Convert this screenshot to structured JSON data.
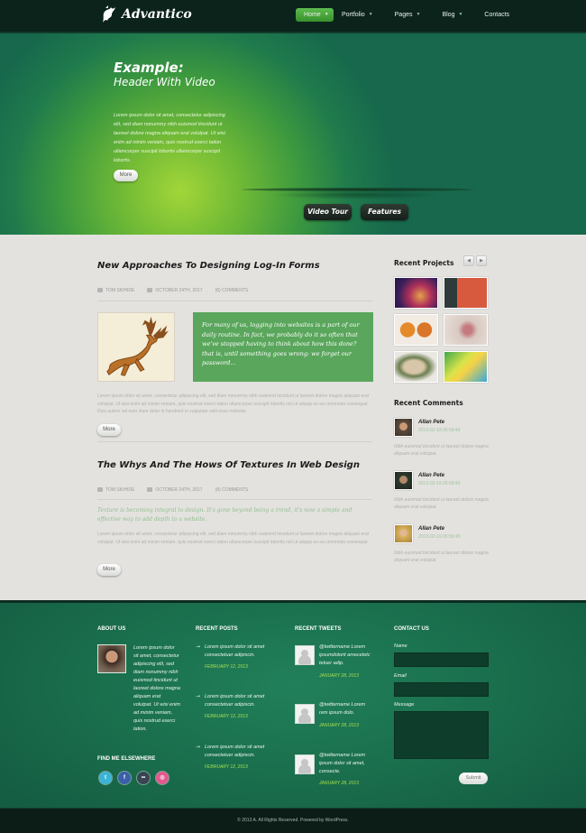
{
  "header": {
    "logo_text": "Advantico",
    "nav": [
      {
        "label": "Home",
        "active": true
      },
      {
        "label": "Portfolio"
      },
      {
        "label": "Pages"
      },
      {
        "label": "Blog"
      },
      {
        "label": "Contacts"
      }
    ]
  },
  "hero": {
    "title": "Example:",
    "subtitle": "Header With Video",
    "text": "Lorem ipsum dolor sit amet, consectetur adipiscing elit, sed diam nonummy nibh euismod tincidunt ut laoreet dolore magna aliquam erat volutpat. Ut wisi enim ad minim veniam, quis nostrud exerci tation ullamcorper suscipit lobortis ullamcorper suscipit lobortis.",
    "more_button": "More",
    "video_tour_button": "Video Tour",
    "features_button": "Features"
  },
  "posts": [
    {
      "title": "New Approaches To Designing Log-In Forms",
      "author": "TOM SKIHIDE",
      "date": "OCTOBER 24TH, 2017",
      "comments": "(8) COMMENTS",
      "quote": "For many of us, logging into websites is a part of our daily routine. In fact, we probably do it so often that we've stopped having to think about how this done? that is, until something goes wrong: we forget our password…",
      "text": "Lorem ipsum dolor sit amet, consectetur adipiscing elit, sed diam nonummy nibh euismod tincidunt ut laoreet dolore magna aliquam erat volutpat. Ut wisi enim ad minim veniam, quis nostrud exerci tation ullamcorper suscipit lobortis nisl ut aliquip ex ea commodo consequat. Duis autem vel eum iriure dolor in hendrerit in vulputate velit esse molestie.",
      "more_button": "More"
    },
    {
      "title": "The Whys And The Hows Of Textures In Web Design",
      "author": "TOM SKIHIDE",
      "date": "OCTOBER 24TH, 2017",
      "comments": "(8) COMMENTS",
      "lead": "Texture is becoming integral to design. It's gone beyond being a trend, it's now a simple and effective way to add depth to a website.",
      "text": "Lorem ipsum dolor sit amet, consectetur adipiscing elit, sed diam nonummy nibh euismod tincidunt ut laoreet dolore magna aliquam erat volutpat. Ut wisi enim ad minim veniam, quis nostrud exerci tation ullamcorper suscipit lobortis nisl ut aliquip ex ea commodo consequat.",
      "more_button": "More"
    }
  ],
  "sidebar": {
    "projects_title": "Recent Projects",
    "comments_title": "Recent Comments",
    "comments": [
      {
        "name": "Allan Pete",
        "date": "2013-02-19 05:58:49",
        "text": "Nibh euismod tincidunt ut laoreet dolore magna aliquam erat volutpat."
      },
      {
        "name": "Allan Pete",
        "date": "2013-02-19 05:58:49",
        "text": "Nibh euismod tincidunt ut laoreet dolore magna aliquam erat volutpat."
      },
      {
        "name": "Allan Pete",
        "date": "2013-02-19 05:58:49",
        "text": "Nibh euismod tincidunt ut laoreet dolore magna aliquam erat volutpat."
      }
    ]
  },
  "footer": {
    "about_title": "ABOUT US",
    "about_text": "Lorem ipsum dolor sit amet, consectetur adipiscing elit, sed diam nonummy nibh euismod tincidunt ut laoreet dolore magna aliquam erat volutpat. Ut wisi enim ad minim veniam, quis nostrud exerci tation.",
    "find_title": "FIND ME ELSEWHERE",
    "posts_title": "RECENT POSTS",
    "posts": [
      {
        "text": "Lorem ipsum dolor sit amet consectetuer adipiscin.",
        "date": "FEBRUARY 12, 2013"
      },
      {
        "text": "Lorem ipsum dolor sit amet consectetuer adipiscin.",
        "date": "FEBRUARY 12, 2013"
      },
      {
        "text": "Lorem ipsum dolor sit amet consectetuer adipiscin.",
        "date": "FEBRUARY 12, 2013"
      }
    ],
    "tweets_title": "RECENT TWEETS",
    "tweets": [
      {
        "text": "@twittername Lorem ipsumdolorit amecetetc tetuer adip.",
        "date": "JANUARY 28, 2013"
      },
      {
        "text": "@twittername Lorem rem ipsum dolo.",
        "date": "JANUARY 28, 2013"
      },
      {
        "text": "@twittername Lorem ipsum dolor sit amet, consecte.",
        "date": "JANUARY 28, 2013"
      }
    ],
    "contact_title": "CONTACT US",
    "name_label": "Name",
    "email_label": "Email",
    "message_label": "Message",
    "submit_button": "Submit"
  },
  "copyright": "© 2013 A. All Rights Reserved. Powered by WordPress."
}
